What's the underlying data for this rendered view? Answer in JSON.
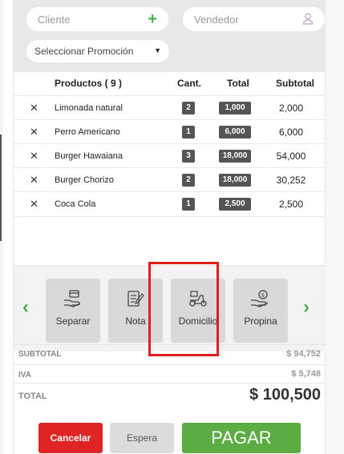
{
  "customer": {
    "placeholder": "Cliente",
    "icon": "plus-icon"
  },
  "seller": {
    "placeholder": "Vendedor",
    "icon": "user-icon"
  },
  "promotion": {
    "selected": "Seleccionar Promoción"
  },
  "table": {
    "headers": {
      "products": "Productos ( 9 )",
      "qty": "Cant.",
      "total": "Total",
      "subtotal": "Subtotal"
    },
    "rows": [
      {
        "name": "Limonada natural",
        "qty": "2",
        "total": "1,000",
        "subtotal": "2,000"
      },
      {
        "name": "Perro Americano",
        "qty": "1",
        "total": "6,000",
        "subtotal": "6,000"
      },
      {
        "name": "Burger Hawaiana",
        "qty": "3",
        "total": "18,000",
        "subtotal": "54,000"
      },
      {
        "name": "Burger Chorizo",
        "qty": "2",
        "total": "18,000",
        "subtotal": "30,252"
      },
      {
        "name": "Coca Cola",
        "qty": "1",
        "total": "2,500",
        "subtotal": "2,500"
      }
    ]
  },
  "payment_options": [
    {
      "label": "Separar",
      "icon": "card-hand-icon"
    },
    {
      "label": "Nota",
      "icon": "note-icon"
    },
    {
      "label": "Domicilio",
      "icon": "scooter-icon"
    },
    {
      "label": "Propina",
      "icon": "tip-icon"
    }
  ],
  "totals": {
    "subtotal_label": "SUBTOTAL",
    "subtotal_value": "$ 94,752",
    "iva_label": "IVA",
    "iva_value": "$ 5,748",
    "total_label": "TOTAL",
    "total_value": "$ 100,500"
  },
  "actions": {
    "cancel": "Cancelar",
    "hold": "Espera",
    "pay": "PAGAR"
  },
  "colors": {
    "accent": "#5bad43",
    "danger": "#e02424",
    "highlight": "#e51c1c"
  }
}
